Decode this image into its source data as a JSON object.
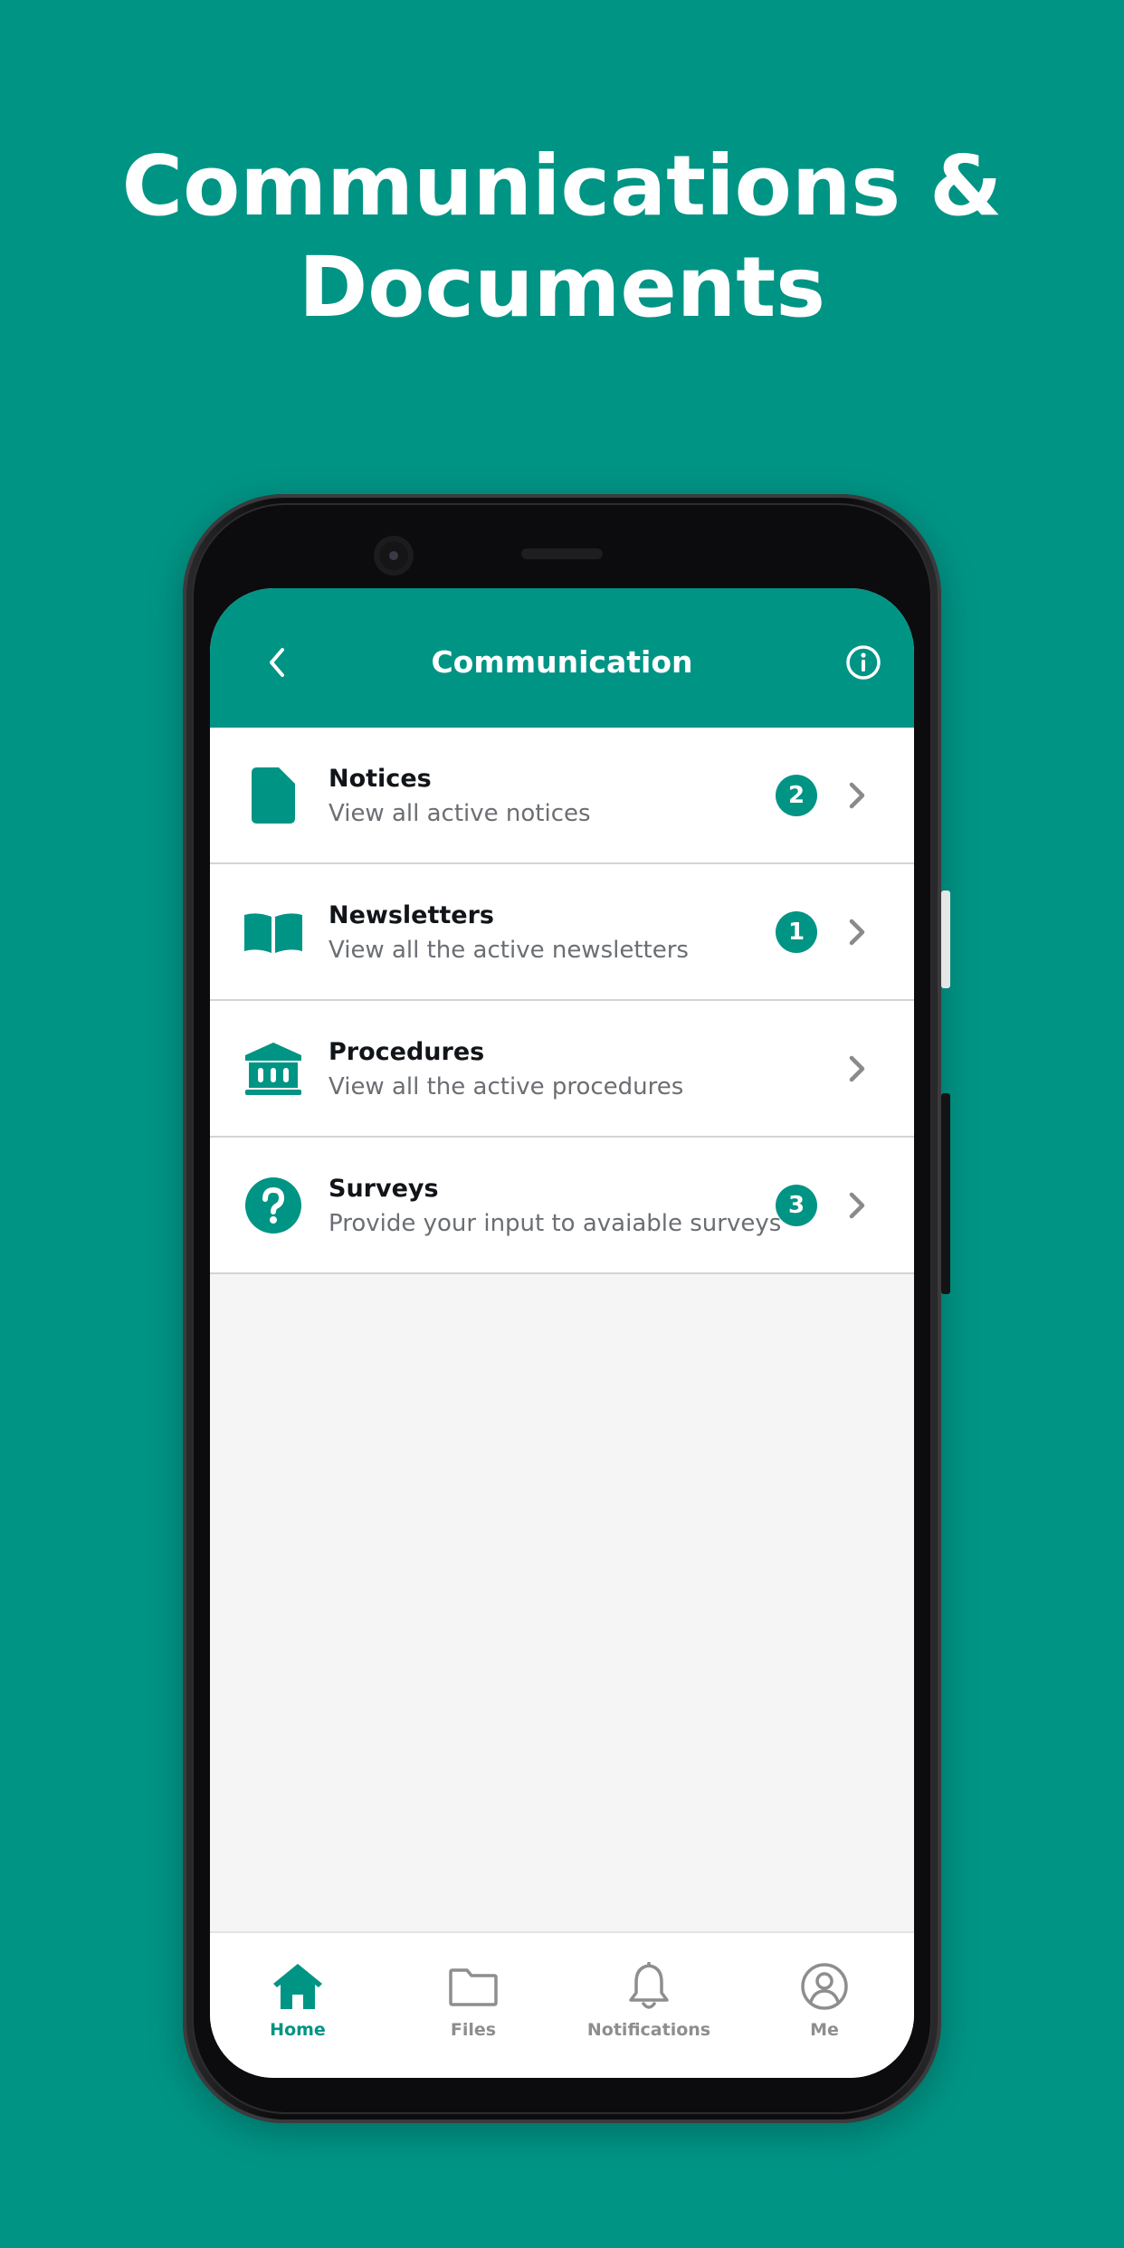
{
  "promo": {
    "title_line1": "Communications &",
    "title_line2": "Documents"
  },
  "header": {
    "title": "Communication"
  },
  "menu": {
    "items": [
      {
        "icon": "document-icon",
        "title": "Notices",
        "subtitle": "View all active notices",
        "badge": "2"
      },
      {
        "icon": "book-icon",
        "title": "Newsletters",
        "subtitle": "View all the active newsletters",
        "badge": "1"
      },
      {
        "icon": "bank-icon",
        "title": "Procedures",
        "subtitle": "View all the active procedures",
        "badge": ""
      },
      {
        "icon": "question-circle-icon",
        "title": "Surveys",
        "subtitle": "Provide your input to avaiable surveys",
        "badge": "3"
      }
    ]
  },
  "bottom_nav": {
    "items": [
      {
        "icon": "home-icon",
        "label": "Home",
        "active": true
      },
      {
        "icon": "folder-icon",
        "label": "Files",
        "active": false
      },
      {
        "icon": "bell-icon",
        "label": "Notifications",
        "active": false
      },
      {
        "icon": "user-circle-icon",
        "label": "Me",
        "active": false
      }
    ]
  },
  "colors": {
    "accent": "#009485",
    "title_text": "#111418",
    "subtitle_text": "#6b6e72",
    "inactive_nav": "#8e8e8e",
    "screen_background": "#f5f5f5"
  }
}
